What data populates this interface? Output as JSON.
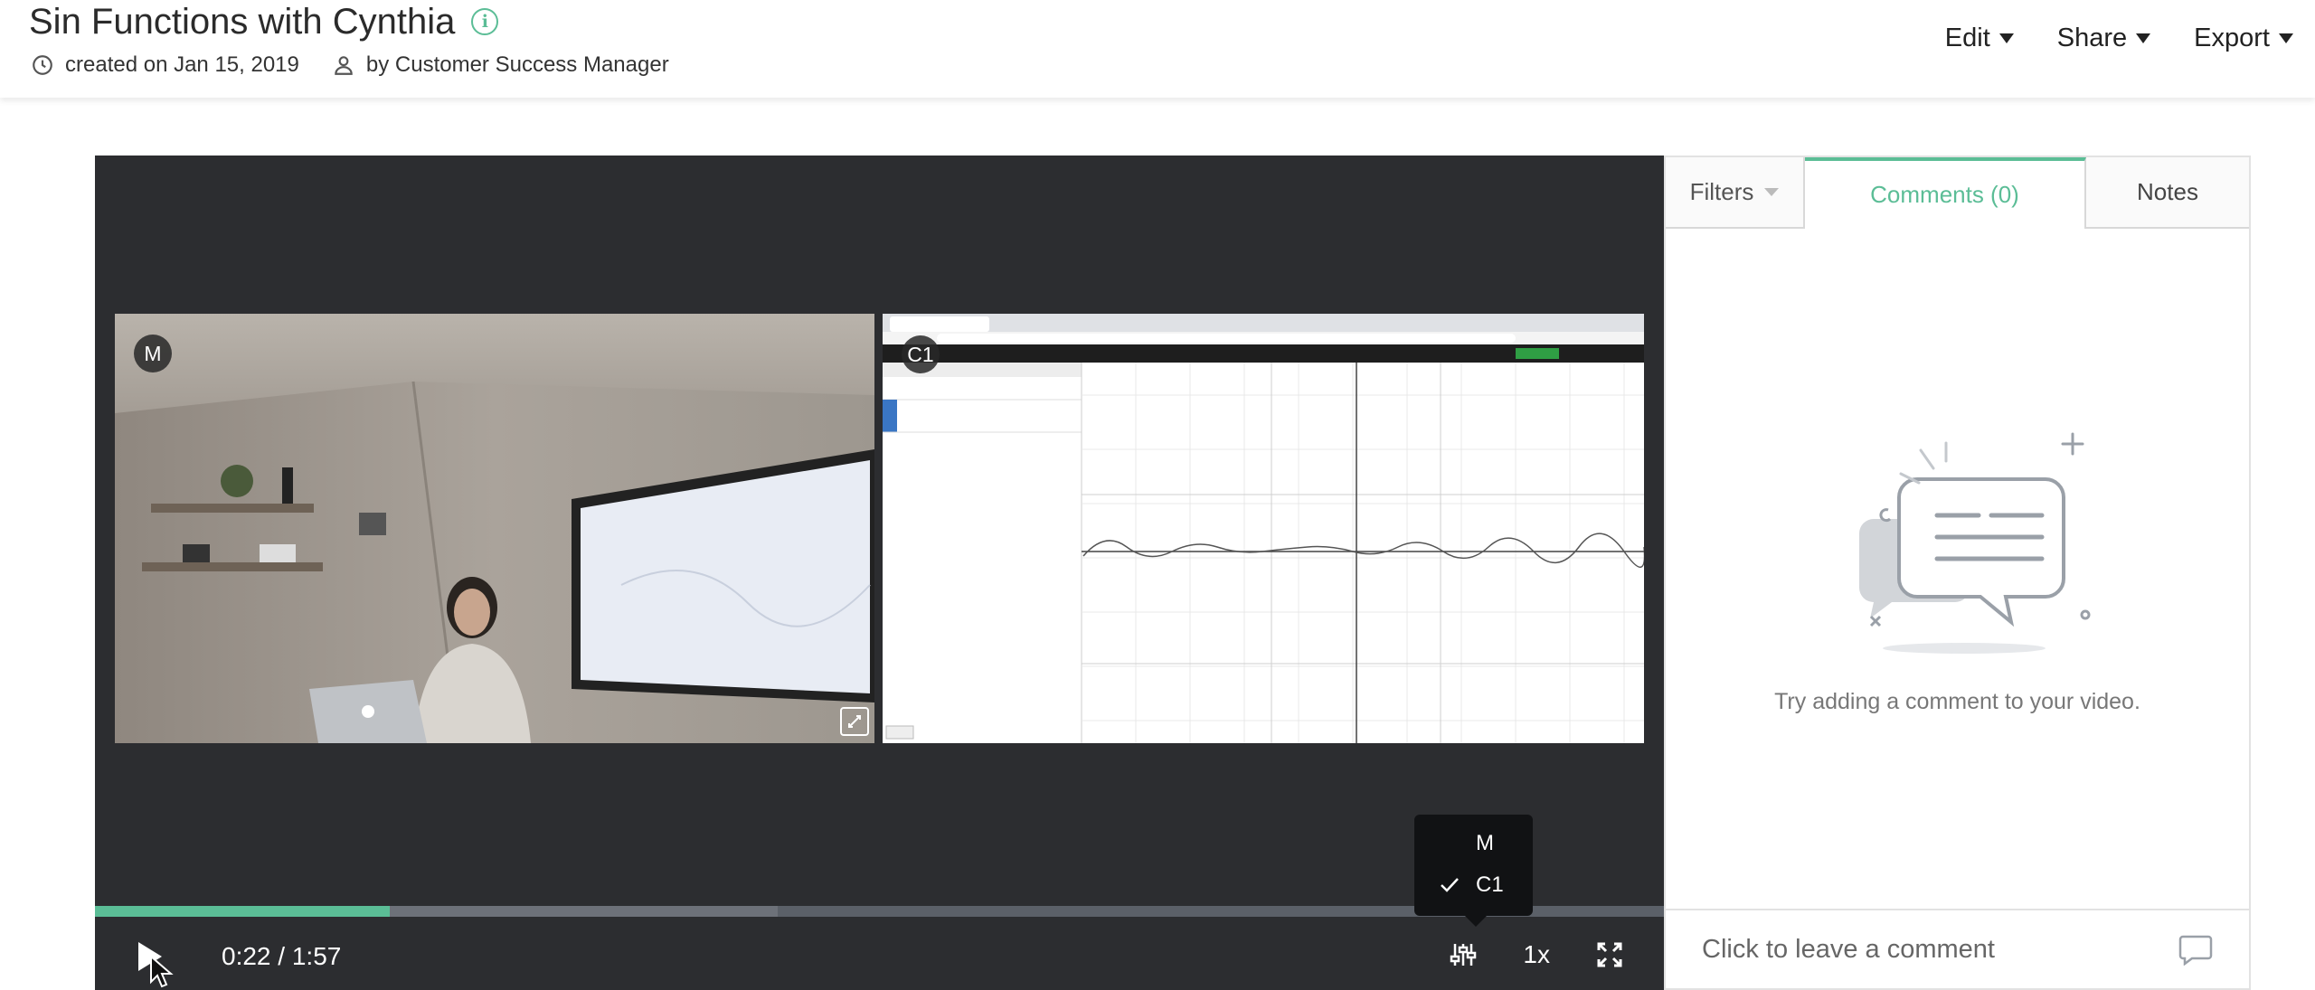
{
  "header": {
    "title": "Sin Functions with Cynthia",
    "created": "created on Jan 15, 2019",
    "author": "by Customer Success Manager",
    "menu": [
      {
        "label": "Edit"
      },
      {
        "label": "Share"
      },
      {
        "label": "Export"
      }
    ]
  },
  "player": {
    "feeds": [
      {
        "badge": "M"
      },
      {
        "badge": "C1"
      }
    ],
    "progress_fraction": 0.188,
    "buffered_fraction": 0.435,
    "time_current": "0:22 /",
    "time_total": "1:57",
    "speed": "1x",
    "source_menu": [
      {
        "label": "M",
        "checked": false
      },
      {
        "label": "C1",
        "checked": true
      }
    ]
  },
  "panel": {
    "tabs": {
      "filters": "Filters",
      "comments": "Comments (0)",
      "notes": "Notes"
    },
    "empty_message": "Try adding a comment to your video.",
    "comment_placeholder": "Click to leave a comment"
  },
  "colors": {
    "accent": "#5bbd96",
    "player_bg": "#2c2d30"
  }
}
